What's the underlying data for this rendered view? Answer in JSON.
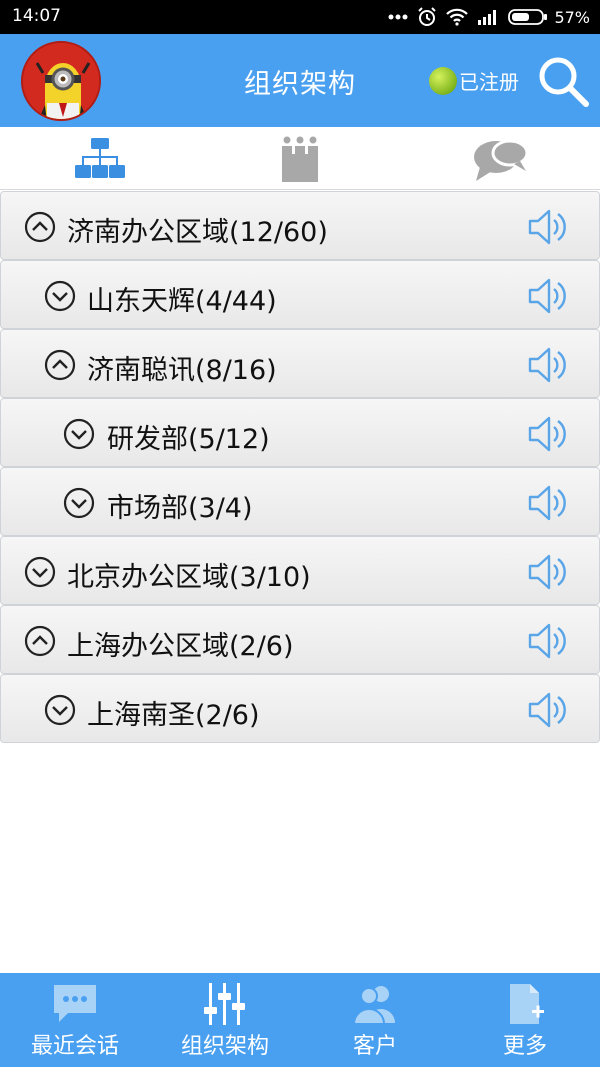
{
  "status_bar": {
    "time": "14:07",
    "battery": "57%"
  },
  "header": {
    "title": "组织架构",
    "registration_label": "已注册",
    "avatar_icon": "minion-avatar-icon",
    "search_icon": "search-icon"
  },
  "tabs": [
    {
      "icon": "org-chart-icon",
      "active": true
    },
    {
      "icon": "group-icon",
      "active": false
    },
    {
      "icon": "chat-bubbles-icon",
      "active": false
    }
  ],
  "tree": [
    {
      "label": "济南办公区域(12/60)",
      "level": 0,
      "expanded": true
    },
    {
      "label": "山东天辉(4/44)",
      "level": 1,
      "expanded": false
    },
    {
      "label": "济南聪讯(8/16)",
      "level": 1,
      "expanded": true
    },
    {
      "label": "研发部(5/12)",
      "level": 2,
      "expanded": false
    },
    {
      "label": "市场部(3/4)",
      "level": 2,
      "expanded": false
    },
    {
      "label": "北京办公区域(3/10)",
      "level": 0,
      "expanded": false
    },
    {
      "label": "上海办公区域(2/6)",
      "level": 0,
      "expanded": true
    },
    {
      "label": "上海南圣(2/6)",
      "level": 1,
      "expanded": false
    }
  ],
  "bottom_nav": [
    {
      "label": "最近会话",
      "icon": "chat-icon"
    },
    {
      "label": "组织架构",
      "icon": "sliders-icon"
    },
    {
      "label": "客户",
      "icon": "customers-icon"
    },
    {
      "label": "更多",
      "icon": "add-document-icon"
    }
  ],
  "colors": {
    "primary": "#4aa0f0",
    "tab_active": "#3b8fe0",
    "tab_inactive": "#a8a8a8",
    "speaker": "#5aa5e8",
    "registered_dot": "#9ccc2a"
  }
}
